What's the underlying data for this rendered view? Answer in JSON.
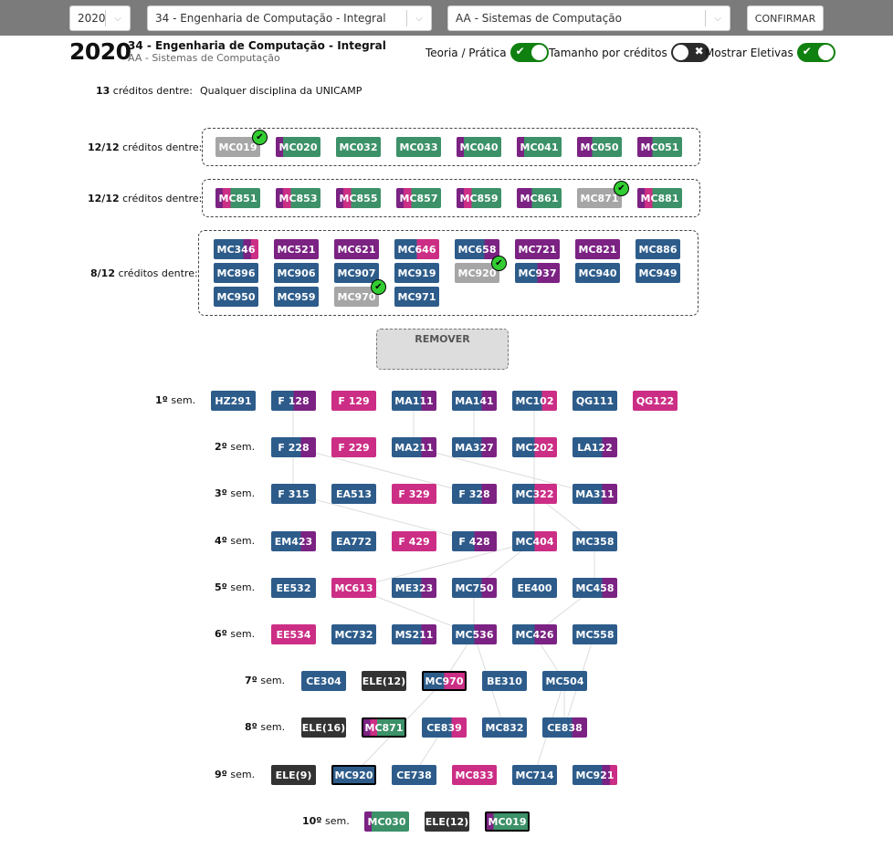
{
  "colors": {
    "blue": "#2d5c8b",
    "purple": "#7b2283",
    "pink": "#cc2e85",
    "green": "#3c9168",
    "grey": "#a6a6a6",
    "dark": "#333333"
  },
  "topbar": {
    "year": "2020",
    "course": "34 - Engenharia de Computação - Integral",
    "modality": "AA - Sistemas de Computação",
    "confirm_label": "CONFIRMAR"
  },
  "header": {
    "year": "2020",
    "course": "34 - Engenharia de Computação - Integral",
    "modality": "AA - Sistemas de Computação"
  },
  "toggles": {
    "theory": {
      "label": "Teoria / Prática",
      "on": true
    },
    "credits": {
      "label": "Tamanho por créditos",
      "on": false
    },
    "electives": {
      "label": "Mostrar Eletivas",
      "on": true
    }
  },
  "requirements": [
    {
      "count": "13",
      "label": " créditos dentre:",
      "text": "Qualquer disciplina da UNICAMP"
    },
    {
      "count": "12/12",
      "label": " créditos dentre:",
      "courses": [
        {
          "code": "MC019",
          "c": [
            "grey"
          ],
          "done": true
        },
        {
          "code": "MC020",
          "c": [
            "purple",
            "green",
            "green",
            "green",
            "green",
            "green"
          ]
        },
        {
          "code": "MC032",
          "c": [
            "green"
          ]
        },
        {
          "code": "MC033",
          "c": [
            "green"
          ]
        },
        {
          "code": "MC040",
          "c": [
            "purple",
            "green",
            "green",
            "green",
            "green",
            "green"
          ]
        },
        {
          "code": "MC041",
          "c": [
            "purple",
            "green",
            "green",
            "green",
            "green",
            "green"
          ]
        },
        {
          "code": "MC050",
          "c": [
            "purple",
            "purple",
            "green",
            "green",
            "green",
            "green"
          ]
        },
        {
          "code": "MC051",
          "c": [
            "purple",
            "purple",
            "green",
            "green",
            "green",
            "green"
          ]
        }
      ]
    },
    {
      "count": "12/12",
      "label": " créditos dentre:",
      "courses": [
        {
          "code": "MC851",
          "c": [
            "purple",
            "pink",
            "green",
            "green",
            "green",
            "green"
          ]
        },
        {
          "code": "MC853",
          "c": [
            "purple",
            "pink",
            "green",
            "green",
            "green",
            "green"
          ]
        },
        {
          "code": "MC855",
          "c": [
            "purple",
            "pink",
            "green",
            "green",
            "green",
            "green"
          ]
        },
        {
          "code": "MC857",
          "c": [
            "purple",
            "pink",
            "green",
            "green",
            "green",
            "green"
          ]
        },
        {
          "code": "MC859",
          "c": [
            "purple",
            "pink",
            "green",
            "green",
            "green",
            "green"
          ]
        },
        {
          "code": "MC861",
          "c": [
            "purple",
            "purple",
            "green",
            "green",
            "green",
            "green"
          ]
        },
        {
          "code": "MC871",
          "c": [
            "grey"
          ],
          "done": true
        },
        {
          "code": "MC881",
          "c": [
            "purple",
            "pink",
            "green",
            "green",
            "green",
            "green"
          ]
        }
      ]
    },
    {
      "count": "8/12",
      "label": " créditos dentre:",
      "courses": [
        {
          "code": "MC346",
          "c": [
            "blue",
            "blue",
            "blue",
            "blue",
            "purple",
            "pink"
          ]
        },
        {
          "code": "MC521",
          "c": [
            "purple"
          ]
        },
        {
          "code": "MC621",
          "c": [
            "purple"
          ]
        },
        {
          "code": "MC646",
          "c": [
            "blue",
            "blue",
            "blue",
            "pink",
            "pink",
            "pink"
          ]
        },
        {
          "code": "MC658",
          "c": [
            "blue",
            "blue",
            "blue",
            "blue",
            "purple",
            "purple"
          ]
        },
        {
          "code": "MC721",
          "c": [
            "purple"
          ]
        },
        {
          "code": "MC821",
          "c": [
            "purple"
          ]
        },
        {
          "code": "MC886",
          "c": [
            "blue"
          ]
        },
        {
          "code": "MC896",
          "c": [
            "blue"
          ]
        },
        {
          "code": "MC906",
          "c": [
            "blue"
          ]
        },
        {
          "code": "MC907",
          "c": [
            "blue"
          ]
        },
        {
          "code": "MC919",
          "c": [
            "blue"
          ]
        },
        {
          "code": "MC920",
          "c": [
            "grey"
          ],
          "done": true
        },
        {
          "code": "MC937",
          "c": [
            "blue",
            "blue",
            "blue",
            "purple",
            "purple",
            "purple"
          ]
        },
        {
          "code": "MC940",
          "c": [
            "blue"
          ]
        },
        {
          "code": "MC949",
          "c": [
            "blue"
          ]
        },
        {
          "code": "MC950",
          "c": [
            "blue"
          ]
        },
        {
          "code": "MC959",
          "c": [
            "blue"
          ]
        },
        {
          "code": "MC970",
          "c": [
            "grey"
          ],
          "done": true
        },
        {
          "code": "MC971",
          "c": [
            "blue"
          ]
        }
      ]
    }
  ],
  "remove_label": "REMOVER",
  "semesters": [
    {
      "n": "1º",
      "courses": [
        {
          "code": "HZ291",
          "c": [
            "blue"
          ]
        },
        {
          "code": "F 128",
          "c": [
            "blue",
            "blue",
            "blue",
            "purple",
            "purple",
            "purple"
          ]
        },
        {
          "code": "F 129",
          "c": [
            "pink"
          ]
        },
        {
          "code": "MA111",
          "c": [
            "blue",
            "blue",
            "blue",
            "blue",
            "purple",
            "purple"
          ]
        },
        {
          "code": "MA141",
          "c": [
            "blue",
            "blue",
            "blue",
            "blue",
            "purple",
            "purple"
          ]
        },
        {
          "code": "MC102",
          "c": [
            "blue",
            "blue",
            "blue",
            "blue",
            "pink",
            "pink"
          ]
        },
        {
          "code": "QG111",
          "c": [
            "blue"
          ]
        },
        {
          "code": "QG122",
          "c": [
            "pink"
          ]
        }
      ]
    },
    {
      "n": "2º",
      "courses": [
        {
          "code": "F 228",
          "c": [
            "blue",
            "blue",
            "blue",
            "blue",
            "purple",
            "purple"
          ]
        },
        {
          "code": "F 229",
          "c": [
            "pink"
          ]
        },
        {
          "code": "MA211",
          "c": [
            "blue",
            "blue",
            "blue",
            "blue",
            "purple",
            "purple"
          ]
        },
        {
          "code": "MA327",
          "c": [
            "blue",
            "blue",
            "blue",
            "blue",
            "purple",
            "purple"
          ]
        },
        {
          "code": "MC202",
          "c": [
            "blue",
            "blue",
            "blue",
            "pink",
            "pink",
            "pink"
          ]
        },
        {
          "code": "LA122",
          "c": [
            "blue",
            "blue",
            "blue",
            "blue",
            "purple",
            "purple"
          ]
        }
      ]
    },
    {
      "n": "3º",
      "courses": [
        {
          "code": "F 315",
          "c": [
            "blue"
          ]
        },
        {
          "code": "EA513",
          "c": [
            "blue"
          ]
        },
        {
          "code": "F 329",
          "c": [
            "pink"
          ]
        },
        {
          "code": "F 328",
          "c": [
            "blue",
            "blue",
            "blue",
            "blue",
            "purple",
            "purple"
          ]
        },
        {
          "code": "MC322",
          "c": [
            "blue",
            "blue",
            "blue",
            "pink",
            "pink",
            "pink"
          ]
        },
        {
          "code": "MA311",
          "c": [
            "blue",
            "blue",
            "blue",
            "blue",
            "purple",
            "purple"
          ]
        }
      ]
    },
    {
      "n": "4º",
      "courses": [
        {
          "code": "EM423",
          "c": [
            "blue",
            "blue",
            "blue",
            "blue",
            "purple",
            "purple"
          ]
        },
        {
          "code": "EA772",
          "c": [
            "blue"
          ]
        },
        {
          "code": "F 429",
          "c": [
            "pink"
          ]
        },
        {
          "code": "F 428",
          "c": [
            "blue",
            "blue",
            "blue",
            "purple",
            "purple",
            "purple"
          ]
        },
        {
          "code": "MC404",
          "c": [
            "blue",
            "blue",
            "blue",
            "pink",
            "pink",
            "pink"
          ]
        },
        {
          "code": "MC358",
          "c": [
            "blue"
          ]
        }
      ]
    },
    {
      "n": "5º",
      "courses": [
        {
          "code": "EE532",
          "c": [
            "blue"
          ]
        },
        {
          "code": "MC613",
          "c": [
            "pink"
          ]
        },
        {
          "code": "ME323",
          "c": [
            "blue",
            "blue",
            "blue",
            "blue",
            "purple",
            "purple"
          ]
        },
        {
          "code": "MC750",
          "c": [
            "blue",
            "blue",
            "blue",
            "blue",
            "purple",
            "purple"
          ]
        },
        {
          "code": "EE400",
          "c": [
            "blue"
          ]
        },
        {
          "code": "MC458",
          "c": [
            "blue",
            "blue",
            "blue",
            "blue",
            "purple",
            "purple"
          ]
        }
      ]
    },
    {
      "n": "6º",
      "courses": [
        {
          "code": "EE534",
          "c": [
            "pink"
          ]
        },
        {
          "code": "MC732",
          "c": [
            "blue"
          ]
        },
        {
          "code": "MS211",
          "c": [
            "blue",
            "blue",
            "blue",
            "blue",
            "purple",
            "purple"
          ]
        },
        {
          "code": "MC536",
          "c": [
            "blue",
            "blue",
            "blue",
            "purple",
            "purple",
            "purple"
          ]
        },
        {
          "code": "MC426",
          "c": [
            "blue",
            "blue",
            "blue",
            "purple",
            "purple",
            "purple"
          ]
        },
        {
          "code": "MC558",
          "c": [
            "blue"
          ]
        }
      ]
    },
    {
      "n": "7º",
      "courses": [
        {
          "code": "CE304",
          "c": [
            "blue"
          ]
        },
        {
          "code": "ELE(12)",
          "c": [
            "dark"
          ]
        },
        {
          "code": "MC970",
          "c": [
            "blue",
            "blue",
            "blue",
            "pink",
            "pink",
            "pink"
          ],
          "selected": true
        },
        {
          "code": "BE310",
          "c": [
            "blue"
          ]
        },
        {
          "code": "MC504",
          "c": [
            "blue"
          ]
        }
      ]
    },
    {
      "n": "8º",
      "courses": [
        {
          "code": "ELE(16)",
          "c": [
            "dark"
          ]
        },
        {
          "code": "MC871",
          "c": [
            "purple",
            "pink",
            "green",
            "green",
            "green",
            "green"
          ],
          "selected": true
        },
        {
          "code": "CE839",
          "c": [
            "blue",
            "blue",
            "blue",
            "blue",
            "pink",
            "pink"
          ]
        },
        {
          "code": "MC832",
          "c": [
            "blue"
          ]
        },
        {
          "code": "CE838",
          "c": [
            "blue",
            "blue",
            "blue",
            "blue",
            "purple",
            "purple"
          ]
        }
      ]
    },
    {
      "n": "9º",
      "courses": [
        {
          "code": "ELE(9)",
          "c": [
            "dark"
          ]
        },
        {
          "code": "MC920",
          "c": [
            "blue"
          ],
          "selected": true
        },
        {
          "code": "CE738",
          "c": [
            "blue"
          ]
        },
        {
          "code": "MC833",
          "c": [
            "pink"
          ]
        },
        {
          "code": "MC714",
          "c": [
            "blue"
          ]
        },
        {
          "code": "MC921",
          "c": [
            "blue",
            "blue",
            "blue",
            "blue",
            "purple",
            "pink"
          ]
        }
      ]
    },
    {
      "n": "10º",
      "courses": [
        {
          "code": "MC030",
          "c": [
            "purple",
            "green",
            "green",
            "green",
            "green",
            "green"
          ]
        },
        {
          "code": "ELE(12)",
          "c": [
            "dark"
          ]
        },
        {
          "code": "MC019",
          "c": [
            "purple",
            "green",
            "green",
            "green",
            "green",
            "green"
          ],
          "selected": true
        }
      ]
    }
  ]
}
